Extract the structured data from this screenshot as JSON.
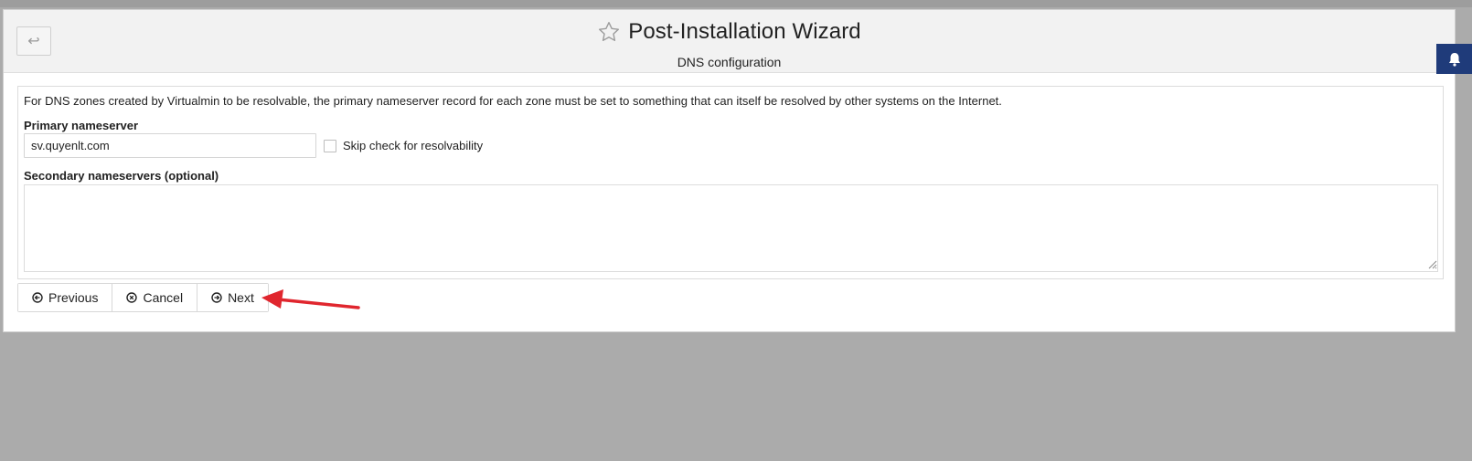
{
  "header": {
    "title": "Post-Installation Wizard",
    "subtitle": "DNS configuration",
    "back_icon": "return-arrow-icon",
    "star_icon": "star-outline-icon",
    "bell_icon": "bell-icon"
  },
  "form": {
    "intro": "For DNS zones created by Virtualmin to be resolvable, the primary nameserver record for each zone must be set to something that can itself be resolved by other systems on the Internet.",
    "primary_label": "Primary nameserver",
    "primary_value": "sv.quyenlt.com",
    "skip_label": "Skip check for resolvability",
    "skip_checked": false,
    "secondary_label": "Secondary nameservers (optional)",
    "secondary_value": ""
  },
  "buttons": {
    "previous": "Previous",
    "cancel": "Cancel",
    "next": "Next"
  },
  "colors": {
    "annotation_arrow": "#e0262e",
    "bell_bg": "#1f3b7a",
    "background": "#ababab"
  }
}
